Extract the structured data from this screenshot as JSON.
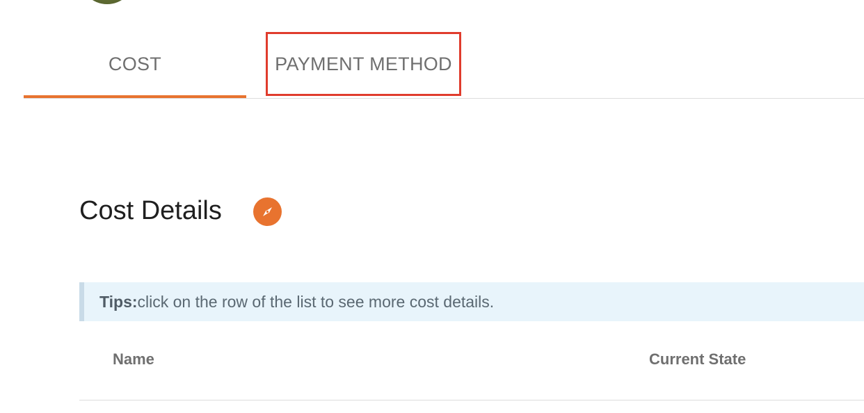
{
  "tabs": [
    {
      "label": "COST",
      "active": true
    },
    {
      "label": "PAYMENT METHOD",
      "active": false,
      "highlighted": true
    }
  ],
  "section": {
    "title": "Cost Details",
    "icon": "compass-icon"
  },
  "tips": {
    "label": "Tips:",
    "text": "click on the row of the list to see more cost details."
  },
  "table": {
    "columns": [
      "Name",
      "Current State"
    ]
  },
  "colors": {
    "accent": "#e8732f",
    "highlight_border": "#e03c2d",
    "tips_background": "#e8f4fb"
  }
}
